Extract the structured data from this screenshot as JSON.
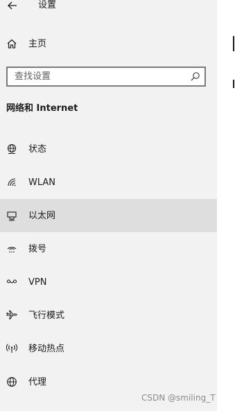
{
  "window": {
    "title": "设置"
  },
  "home": {
    "label": "主页",
    "icon": "home-icon"
  },
  "search": {
    "placeholder": "查找设置",
    "value": "",
    "icon": "search-icon"
  },
  "section": {
    "title": "网络和 Internet"
  },
  "nav_items": [
    {
      "label": "状态",
      "icon": "globe-status-icon",
      "selected": false
    },
    {
      "label": "WLAN",
      "icon": "wifi-icon",
      "selected": false
    },
    {
      "label": "以太网",
      "icon": "ethernet-icon",
      "selected": true
    },
    {
      "label": "拨号",
      "icon": "dialup-icon",
      "selected": false
    },
    {
      "label": "VPN",
      "icon": "vpn-icon",
      "selected": false
    },
    {
      "label": "飞行模式",
      "icon": "airplane-icon",
      "selected": false
    },
    {
      "label": "移动热点",
      "icon": "hotspot-icon",
      "selected": false
    },
    {
      "label": "代理",
      "icon": "proxy-globe-icon",
      "selected": false
    }
  ],
  "watermark": "CSDN @smiling_T",
  "colors": {
    "sidebar_bg": "#f2f2f2",
    "selected_bg": "#dedede",
    "text": "#1a1a1a",
    "search_border": "#7a7a7a"
  }
}
